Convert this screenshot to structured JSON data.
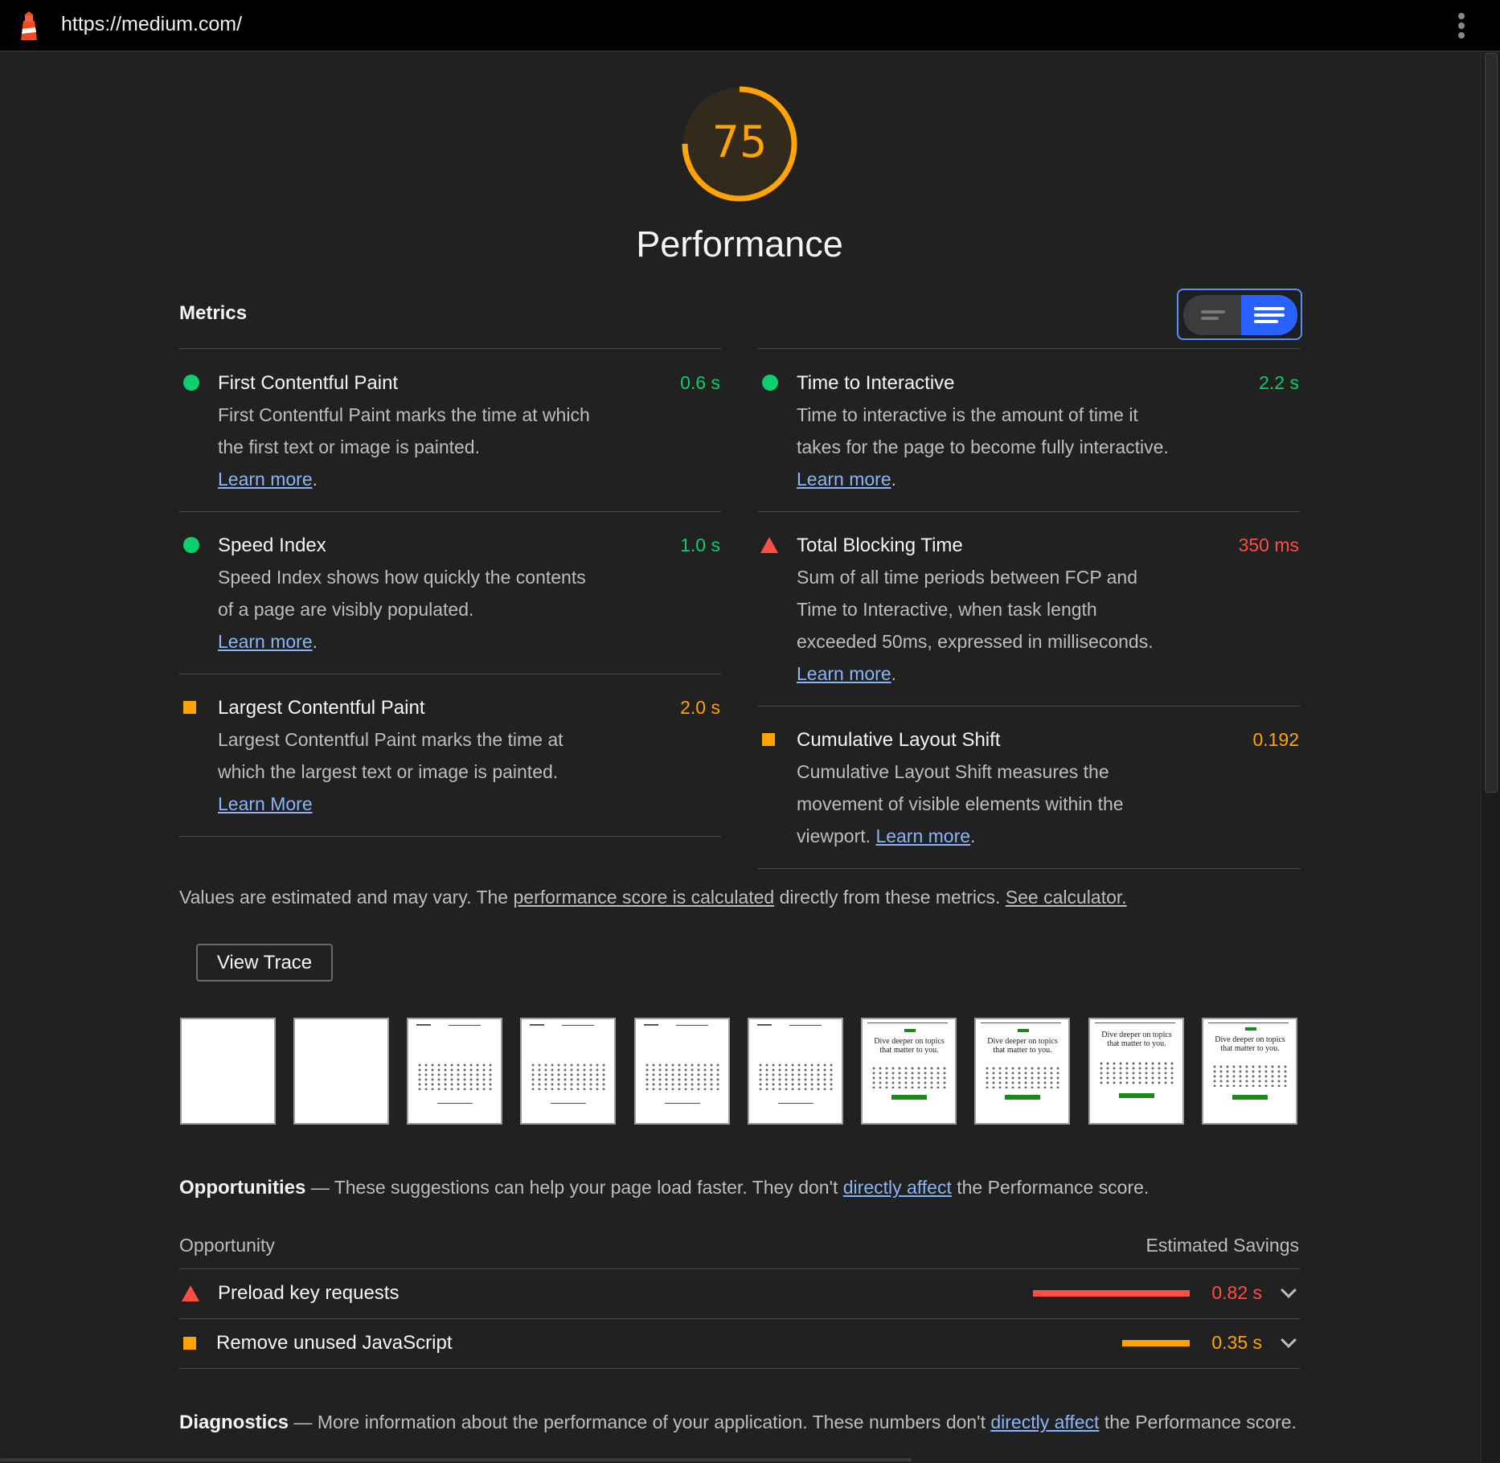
{
  "topbar": {
    "url": "https://medium.com/"
  },
  "category": {
    "score": "75",
    "score_fraction": 0.75,
    "title": "Performance",
    "color": "#ffa400"
  },
  "metrics": {
    "header": "Metrics",
    "fcp": {
      "title": "First Contentful Paint",
      "value": "0.6 s",
      "desc": "First Contentful Paint marks the time at which the first text or image is painted.",
      "link": "Learn more",
      "status": "pass"
    },
    "si": {
      "title": "Speed Index",
      "value": "1.0 s",
      "desc": "Speed Index shows how quickly the contents of a page are visibly populated.",
      "link": "Learn more",
      "status": "pass"
    },
    "lcp": {
      "title": "Largest Contentful Paint",
      "value": "2.0 s",
      "desc": "Largest Contentful Paint marks the time at which the largest text or image is painted.",
      "link": "Learn More",
      "status": "average"
    },
    "tti": {
      "title": "Time to Interactive",
      "value": "2.2 s",
      "desc": "Time to interactive is the amount of time it takes for the page to become fully interactive.",
      "link": "Learn more",
      "status": "pass"
    },
    "tbt": {
      "title": "Total Blocking Time",
      "value": "350 ms",
      "desc": "Sum of all time periods between FCP and Time to Interactive, when task length exceeded 50ms, expressed in milliseconds.",
      "link": "Learn more",
      "status": "fail"
    },
    "cls": {
      "title": "Cumulative Layout Shift",
      "value": "0.192",
      "desc": "Cumulative Layout Shift measures the movement of visible elements within the viewport.",
      "link": "Learn more",
      "status": "average"
    }
  },
  "note": {
    "part1": "Values are estimated and may vary. The ",
    "link1": "performance score is calculated",
    "part2": " directly from these metrics. ",
    "link2": "See calculator."
  },
  "view_trace": "View Trace",
  "filmstrip": {
    "headline_text": "Dive deeper on topics that matter to you."
  },
  "opportunities": {
    "title": "Opportunities",
    "dash": " — ",
    "desc1": "These suggestions can help your page load faster. They don't ",
    "link": "directly affect",
    "desc2": " the Performance score.",
    "col_left": "Opportunity",
    "col_right": "Estimated Savings",
    "items": [
      {
        "title": "Preload key requests",
        "value": "0.82 s",
        "status": "fail",
        "savings_fraction": 1.0
      },
      {
        "title": "Remove unused JavaScript",
        "value": "0.35 s",
        "status": "average",
        "savings_fraction": 0.43
      }
    ]
  },
  "diagnostics": {
    "title": "Diagnostics",
    "dash": " — ",
    "desc1": "More information about the performance of your application. These numbers don't ",
    "link": "directly affect",
    "desc2": " the Performance score."
  },
  "colors": {
    "pass": "#0cce6b",
    "average": "#ffa400",
    "fail": "#ff4e42",
    "link": "#8ab4f8"
  }
}
